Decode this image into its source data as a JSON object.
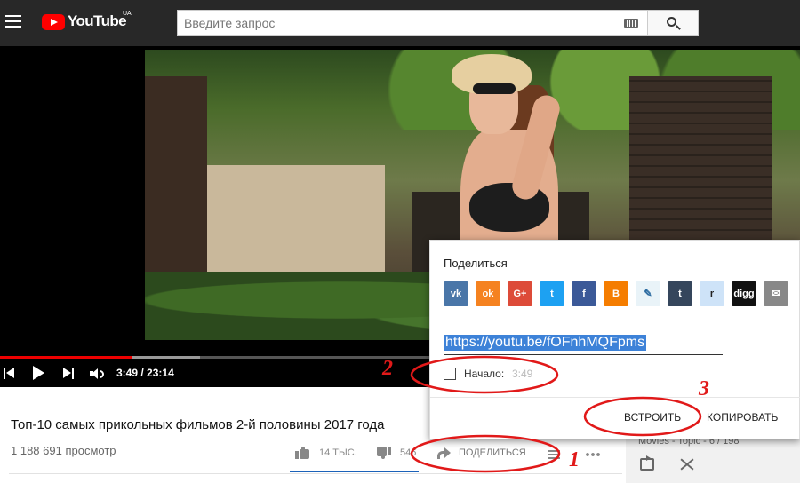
{
  "masthead": {
    "logo_text": "YouTube",
    "logo_country": "UA",
    "search_placeholder": "Введите запрос"
  },
  "player": {
    "time_current": "3:49",
    "time_separator": " / ",
    "time_total": "23:14",
    "progress_played_fraction": 0.164,
    "progress_buffered_fraction": 0.25
  },
  "video": {
    "title": "Топ-10 самых прикольных фильмов 2-й половины 2017 года",
    "views": "1 188 691 просмотр",
    "likes": "14 ТЫС.",
    "dislikes": "546",
    "share_label": "ПОДЕЛИТЬСЯ"
  },
  "playlist": {
    "meta": "Movies - Topic - 6 / 198"
  },
  "share_dialog": {
    "title": "Поделиться",
    "social_networks": [
      {
        "name": "vk",
        "glyph": "vk",
        "color": "#4a76a8"
      },
      {
        "name": "odnoklassniki",
        "glyph": "ok",
        "color": "#f58220"
      },
      {
        "name": "google-plus",
        "glyph": "G+",
        "color": "#dd4b39"
      },
      {
        "name": "twitter",
        "glyph": "t",
        "color": "#1da1f2"
      },
      {
        "name": "facebook",
        "glyph": "f",
        "color": "#3b5998"
      },
      {
        "name": "blogger",
        "glyph": "B",
        "color": "#f57d00"
      },
      {
        "name": "livejournal",
        "glyph": "✎",
        "color": "#e9f3f8"
      },
      {
        "name": "tumblr",
        "glyph": "t",
        "color": "#35465c"
      },
      {
        "name": "reddit",
        "glyph": "r",
        "color": "#cee3f8"
      },
      {
        "name": "digg",
        "glyph": "digg",
        "color": "#111111"
      },
      {
        "name": "email",
        "glyph": "✉",
        "color": "#888888"
      }
    ],
    "url": "https://youtu.be/fOFnhMQFpms",
    "start_label": "Начало:",
    "start_time": "3:49",
    "embed_label": "ВСТРОИТЬ",
    "copy_label": "КОПИРОВАТЬ"
  },
  "annotations": {
    "step1": "1",
    "step2": "2",
    "step3": "3",
    "color": "#e11919"
  }
}
